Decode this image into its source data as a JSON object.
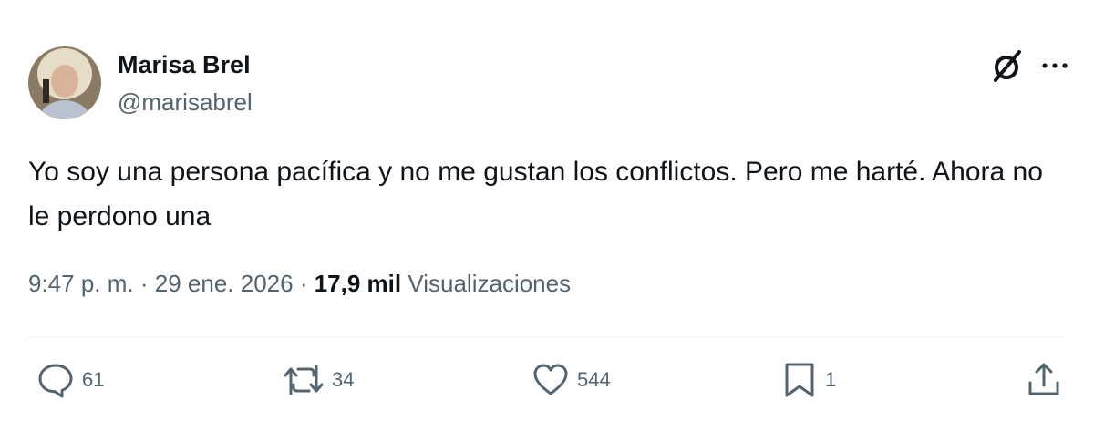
{
  "author": {
    "display_name": "Marisa Brel",
    "handle": "@marisabrel"
  },
  "tweet": {
    "text": "Yo soy una persona pacífica y no me gustan los conflictos. Pero me harté. Ahora no le perdono una",
    "time": "9:47 p. m.",
    "separator": "·",
    "date": "29 ene. 2026",
    "views_count": "17,9 mil",
    "views_label": "Visualizaciones"
  },
  "header_icons": [
    "grok-icon",
    "more-icon"
  ],
  "actions": {
    "replies": "61",
    "retweets": "34",
    "likes": "544",
    "bookmarks": "1"
  },
  "colors": {
    "text": "#0f1419",
    "secondary": "#536471",
    "divider": "#eff3f4"
  }
}
